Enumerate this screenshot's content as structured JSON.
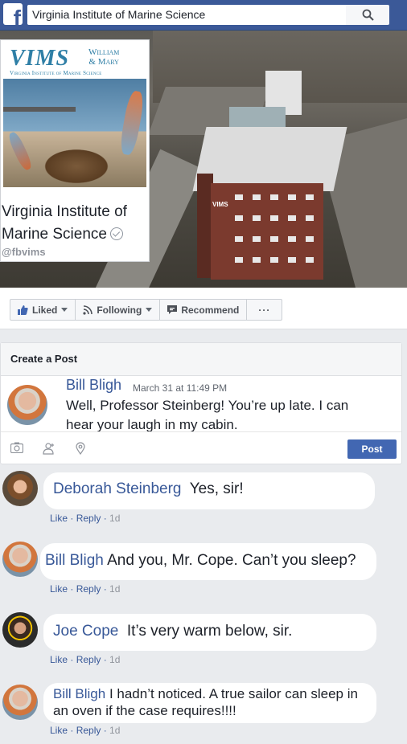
{
  "search": {
    "value": "Virginia Institute of Marine Science"
  },
  "page": {
    "logo_text": "VIMS",
    "logo_partner_line1": "William",
    "logo_partner_line2": "& Mary",
    "logo_subtitle": "Virginia Institute of Marine Science",
    "name": "Virginia Institute of Marine Science",
    "handle": "@fbvims",
    "building_sign": "VIMS"
  },
  "actions": {
    "liked": "Liked",
    "following": "Following",
    "recommend": "Recommend",
    "more": "···"
  },
  "create_post": {
    "title": "Create a Post",
    "author": "Bill Bligh",
    "time": "March 31 at 11:49 PM",
    "text": "Well, Professor Steinberg! You’re up late. I can hear your laugh in my cabin.",
    "post_button": "Post"
  },
  "comments": [
    {
      "author": "Deborah Steinberg",
      "text": "Yes, sir!",
      "like": "Like",
      "reply": "Reply",
      "time": "1d"
    },
    {
      "author": "Bill Bligh",
      "text": "And you, Mr. Cope. Can’t you sleep?",
      "like": "Like",
      "reply": "Reply",
      "time": "1d"
    },
    {
      "author": "Joe Cope",
      "text": "It’s very warm below, sir.",
      "like": "Like",
      "reply": "Reply",
      "time": "1d"
    },
    {
      "author": "Bill Bligh",
      "text": "I hadn’t noticed. A true sailor can sleep in an oven if the case requires!!!!",
      "like": "Like",
      "reply": "Reply",
      "time": "1d"
    }
  ],
  "colors": {
    "brand": "#3b5998",
    "link": "#385898",
    "post_button": "#4267b2"
  }
}
